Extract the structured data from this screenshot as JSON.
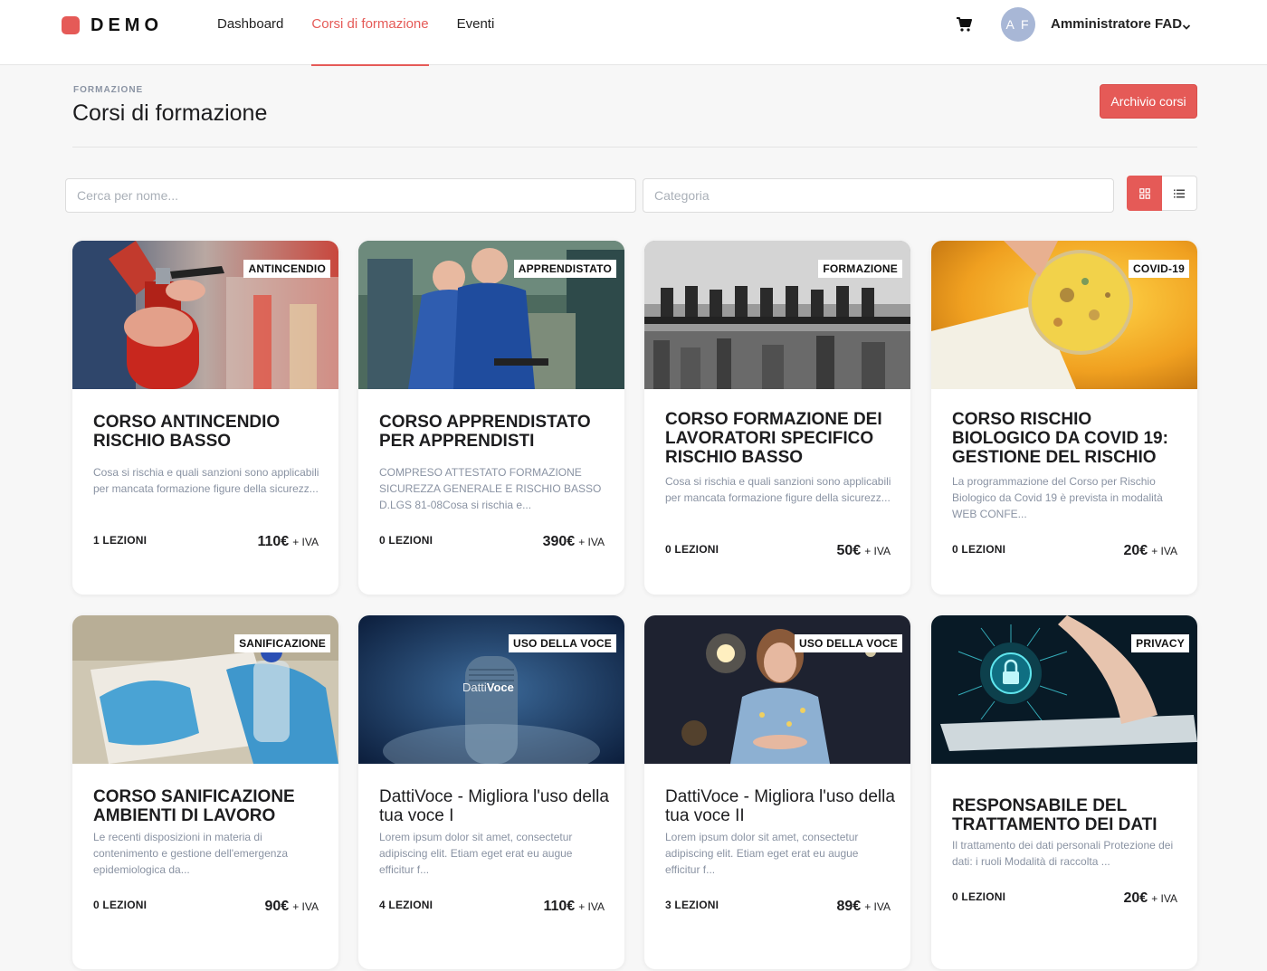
{
  "brand": {
    "name": "DEMO",
    "color": "#e55a57"
  },
  "nav": [
    {
      "label": "Dashboard",
      "active": false
    },
    {
      "label": "Corsi di formazione",
      "active": true
    },
    {
      "label": "Eventi",
      "active": false
    }
  ],
  "user": {
    "initials": "A F",
    "name": "Amministratore FAD"
  },
  "page": {
    "eyebrow": "FORMAZIONE",
    "title": "Corsi di formazione",
    "archive_button": "Archivio corsi"
  },
  "filters": {
    "search_placeholder": "Cerca per nome...",
    "category_placeholder": "Categoria",
    "view_modes": [
      "grid",
      "list"
    ],
    "active_view": "grid"
  },
  "icons": {
    "cart": "cart-icon",
    "chevron": "chevron-down-icon",
    "grid": "grid-view-icon",
    "list": "list-view-icon"
  },
  "courses": [
    {
      "category": "ANTINCENDIO",
      "title": "CORSO ANTINCENDIO RISCHIO BASSO",
      "description": "Cosa si rischia e quali sanzioni sono applicabili per mancata formazione figure della sicurezz...",
      "lessons": "1 LEZIONI",
      "price": "110€",
      "vat": "+ IVA",
      "image": "fire-extinguisher-photo"
    },
    {
      "category": "APPRENDISTATO",
      "title": "CORSO APPRENDISTATO PER APPRENDISTI",
      "description": "COMPRESO ATTESTATO FORMAZIONE SICUREZZA GENERALE E RISCHIO BASSO D.LGS 81-08Cosa si rischia e...",
      "lessons": "0 LEZIONI",
      "price": "390€",
      "vat": "+ IVA",
      "image": "workshop-apprentices-photo"
    },
    {
      "category": "FORMAZIONE",
      "title": "CORSO FORMAZIONE DEI LAVORATORI SPECIFICO RISCHIO BASSO",
      "description": "Cosa si rischia e quali sanzioni sono applicabili per mancata formazione figure della sicurezz...",
      "lessons": "0 LEZIONI",
      "price": "50€",
      "vat": "+ IVA",
      "image": "workers-on-beam-photo"
    },
    {
      "category": "COVID-19",
      "title": "CORSO RISCHIO BIOLOGICO DA COVID 19: GESTIONE DEL RISCHIO",
      "description": "La programmazione del Corso per Rischio Biologico da Covid 19 è prevista in modalità WEB CONFE...",
      "lessons": "0 LEZIONI",
      "price": "20€",
      "vat": "+ IVA",
      "image": "petri-dish-photo"
    },
    {
      "category": "SANIFICAZIONE",
      "title": "CORSO SANIFICAZIONE AMBIENTI DI LAVORO",
      "description": "Le recenti disposizioni in materia di contenimento e gestione dell'emergenza epidemiologica da...",
      "lessons": "0 LEZIONI",
      "price": "90€",
      "vat": "+ IVA",
      "image": "sanitizing-photo"
    },
    {
      "category": "USO DELLA VOCE",
      "title": "DattiVoce - Migliora l'uso della tua voce I",
      "description": " Lorem ipsum dolor sit amet, consectetur adipiscing elit. Etiam eget erat eu augue efficitur f...",
      "lessons": "4 LEZIONI",
      "price": "110€",
      "vat": "+ IVA",
      "image": "microphone-photo",
      "image_text_light": "Datti",
      "image_text_bold": "Voce"
    },
    {
      "category": "USO DELLA VOCE",
      "title": "DattiVoce - Migliora l'uso della tua voce II",
      "description": " Lorem ipsum dolor sit amet, consectetur adipiscing elit. Etiam eget erat eu augue efficitur f...",
      "lessons": "3 LEZIONI",
      "price": "89€",
      "vat": "+ IVA",
      "image": "speaker-woman-photo"
    },
    {
      "category": "PRIVACY",
      "title": "RESPONSABILE DEL TRATTAMENTO DEI DATI",
      "description": "Il trattamento dei dati personali     Protezione dei dati: i ruoli     Modalità di raccolta ...",
      "lessons": "0 LEZIONI",
      "price": "20€",
      "vat": "+ IVA",
      "image": "digital-lock-photo"
    }
  ]
}
